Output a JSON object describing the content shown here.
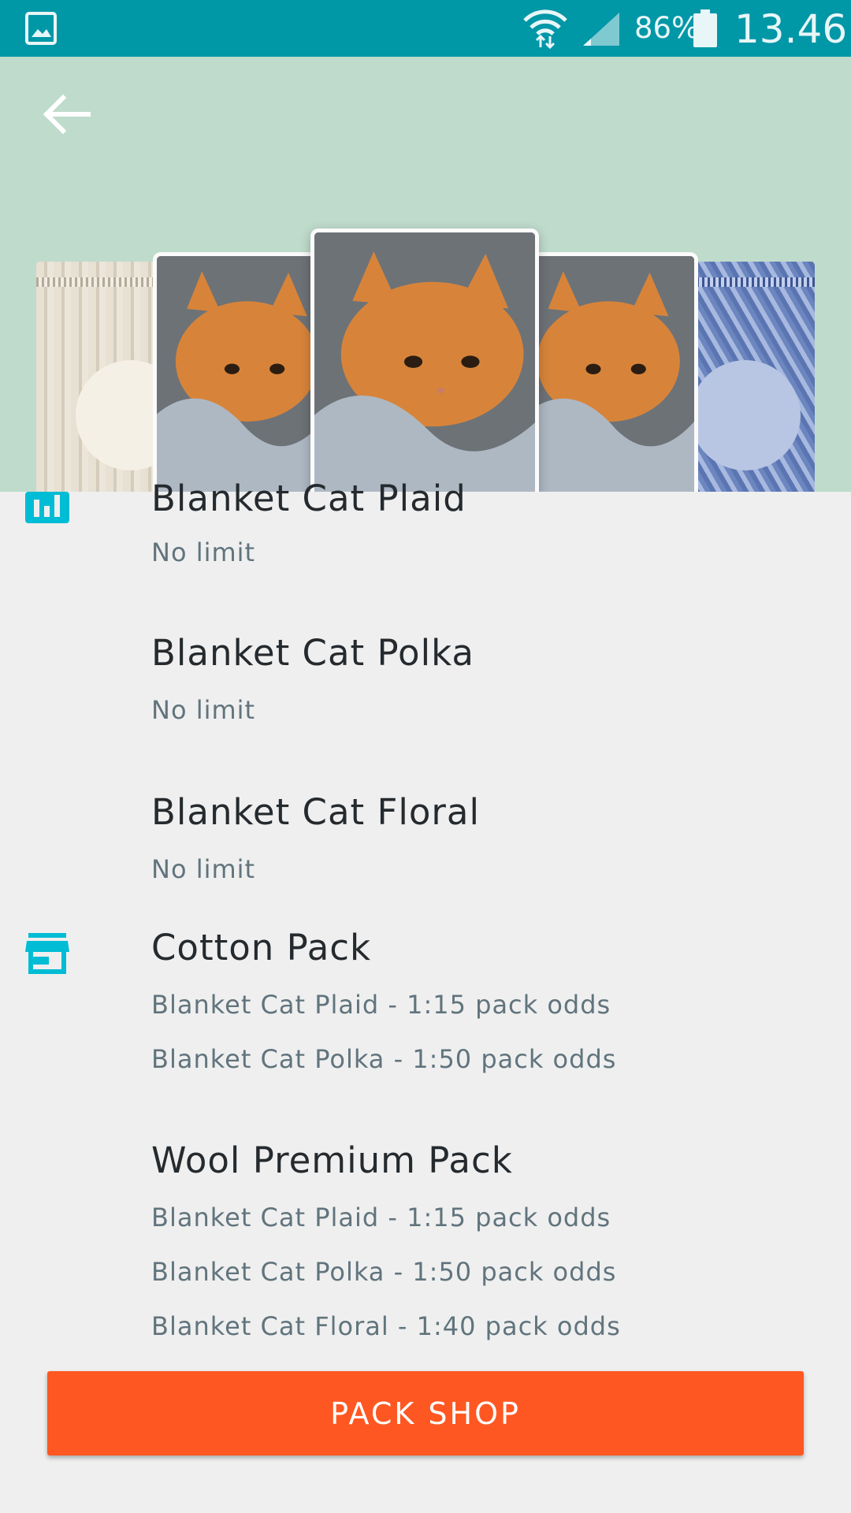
{
  "status_bar": {
    "battery": "86%",
    "time": "13.46"
  },
  "collection": {
    "visible_first_title": "Blanket Cat Plaid",
    "cards": [
      {
        "name": "Blanket Cat Plaid",
        "limit": "No limit"
      },
      {
        "name": "Blanket Cat Polka",
        "limit": "No limit"
      },
      {
        "name": "Blanket Cat Floral",
        "limit": "No limit"
      }
    ]
  },
  "packs": [
    {
      "name": "Cotton Pack",
      "odds": [
        "Blanket Cat Plaid - 1:15 pack odds",
        "Blanket Cat Polka - 1:50 pack odds"
      ]
    },
    {
      "name": "Wool Premium Pack",
      "odds": [
        "Blanket Cat Plaid - 1:15 pack odds",
        "Blanket Cat Polka - 1:50 pack odds",
        "Blanket Cat Floral - 1:40 pack odds"
      ]
    }
  ],
  "icons": {
    "stats": "bar-chart-icon",
    "store": "store-icon",
    "back": "arrow-back-icon"
  },
  "colors": {
    "status_bar": "#0097a7",
    "header_bg": "#bfdbcc",
    "accent": "#00bcd4",
    "button": "#ff5722"
  },
  "actions": {
    "pack_shop": "PACK SHOP"
  }
}
